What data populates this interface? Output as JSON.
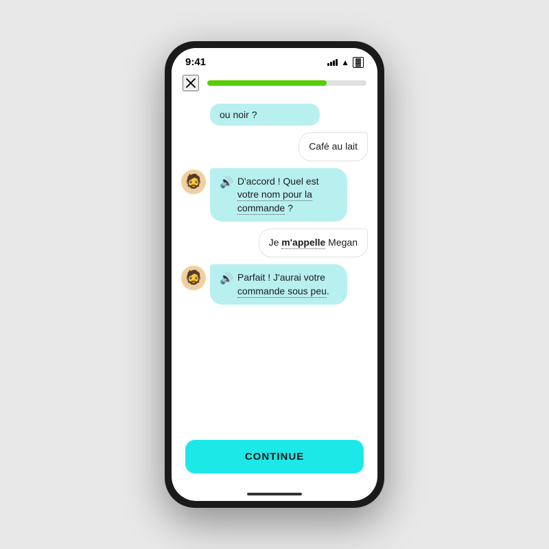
{
  "statusBar": {
    "time": "9:41",
    "signal": "signal-icon",
    "wifi": "wifi-icon",
    "battery": "battery-icon"
  },
  "topBar": {
    "closeLabel": "×",
    "progressPercent": 75
  },
  "messages": [
    {
      "id": "msg1",
      "type": "left-partial",
      "text": "ou noir ?",
      "hasAvatar": false
    },
    {
      "id": "msg2",
      "type": "right",
      "text": "Café au lait",
      "hasAvatar": false
    },
    {
      "id": "msg3",
      "type": "left",
      "speakerIcon": "🔊",
      "text": "D'accord ! Quel est votre nom pour la commande ?",
      "hasAvatar": true,
      "dottedWords": [
        "votre",
        "nom",
        "pour",
        "la",
        "commande"
      ]
    },
    {
      "id": "msg4",
      "type": "right",
      "text": "Je m'appelle Megan",
      "boldWord": "m'appelle",
      "dottedWord": "m'appelle",
      "hasAvatar": false
    },
    {
      "id": "msg5",
      "type": "left",
      "speakerIcon": "🔊",
      "text": "Parfait ! J'aurai votre commande sous peu.",
      "hasAvatar": true,
      "dottedWords": [
        "commande",
        "sous",
        "peu"
      ]
    }
  ],
  "continueButton": {
    "label": "CONTINUE"
  },
  "avatar": {
    "emoji": "🧔"
  }
}
